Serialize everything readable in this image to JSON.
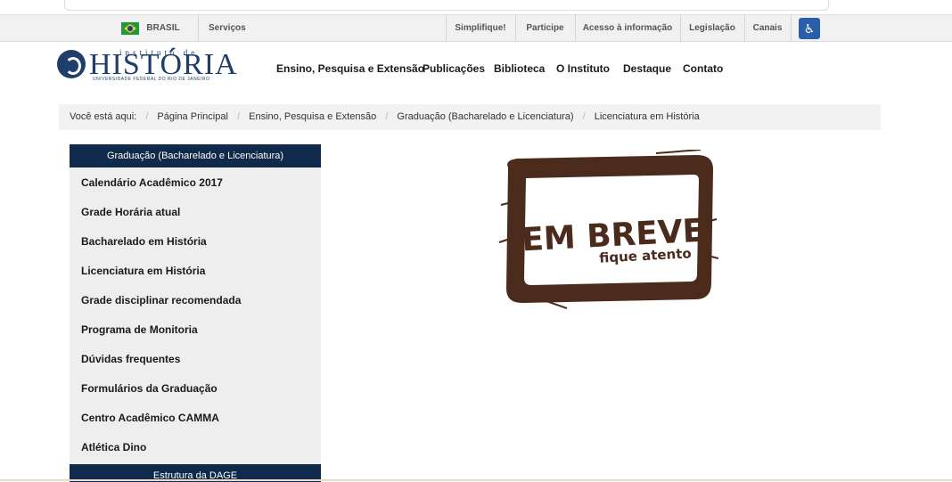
{
  "gov_bar": {
    "country": "BRASIL",
    "services": "Serviços",
    "links": [
      "Simplifique!",
      "Participe",
      "Acesso à informação",
      "Legislação",
      "Canais"
    ]
  },
  "logo": {
    "instituto": "instituto de",
    "historia": "HISTÓRIA",
    "university": "UNIVERSIDADE FEDERAL DO RIO DE JANEIRO"
  },
  "nav": [
    "Ensino, Pesquisa e Extensão",
    "Publicações",
    "Biblioteca",
    "O Instituto",
    "Destaque",
    "Contato"
  ],
  "breadcrumb": {
    "prefix": "Você está aqui:",
    "items": [
      "Página Principal",
      "Ensino, Pesquisa e Extensão",
      "Graduação (Bacharelado e Licenciatura)",
      "Licenciatura em História"
    ]
  },
  "sidebar": {
    "heading": "Graduação (Bacharelado e Licenciatura)",
    "items": [
      "Calendário Acadêmico 2017",
      "Grade Horária atual",
      "Bacharelado em História",
      "Licenciatura em História",
      "Grade disciplinar recomendada",
      "Programa de Monitoria",
      "Dúvidas frequentes",
      "Formulários da Graduação",
      "Centro Acadêmico CAMMA",
      "Atlética Dino"
    ],
    "heading2": "Estrutura da DAGE"
  },
  "stamp": {
    "title": "EM BREVE",
    "subtitle": "fique atento",
    "color": "#4a2b1c"
  }
}
